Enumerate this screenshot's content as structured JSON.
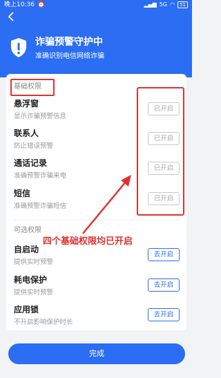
{
  "status": {
    "time": "晚上10:36",
    "signal": "5G",
    "battery": "51"
  },
  "header": {
    "title": "诈骗预警守护中",
    "subtitle": "准确识别电信网络诈骗"
  },
  "basic": {
    "label": "基础权限",
    "items": [
      {
        "title": "悬浮窗",
        "desc": "显示诈骗预警信息",
        "button": "已开启"
      },
      {
        "title": "联系人",
        "desc": "防止错误预警",
        "button": "已开启"
      },
      {
        "title": "通话记录",
        "desc": "准确预警诈骗来电",
        "button": "已开启"
      },
      {
        "title": "短信",
        "desc": "准确预警诈骗短信",
        "button": "已开启"
      }
    ]
  },
  "optional": {
    "label": "可选权限",
    "items": [
      {
        "title": "自启动",
        "desc": "提供实时预警",
        "button": "去开启"
      },
      {
        "title": "耗电保护",
        "desc": "提供实时预警",
        "button": "去开启"
      },
      {
        "title": "应用锁",
        "desc": "不开启影响保护时长",
        "button": "去开启"
      }
    ]
  },
  "annotation": "四个基础权限均已开启",
  "footer": {
    "done_label": "完成"
  },
  "colors": {
    "primary": "#2b6df3",
    "annotation": "#e03131"
  }
}
